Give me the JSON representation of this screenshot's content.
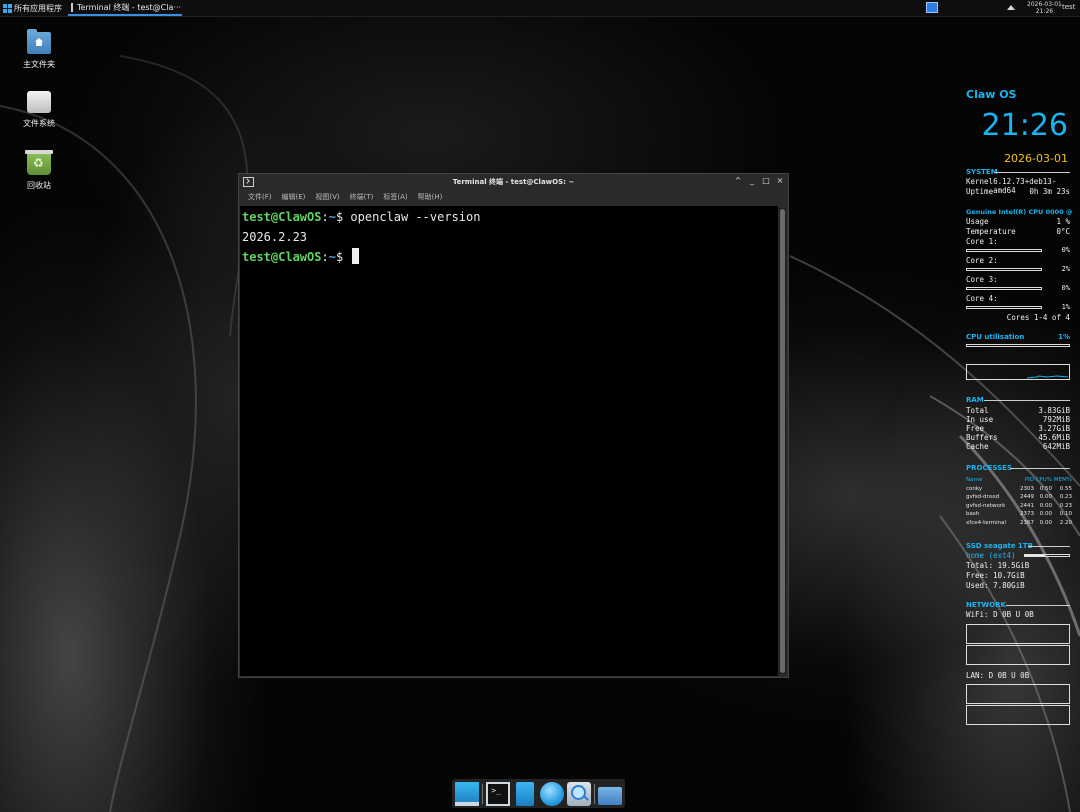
{
  "top_panel": {
    "apps_menu_label": "所有应用程序",
    "task_title": "Terminal 终端 - test@Cla···",
    "clock_date": "2026-03-01",
    "clock_time": "21:26",
    "user": "test"
  },
  "desktop_icons": [
    {
      "label": "主文件夹",
      "icon": "home-folder-icon"
    },
    {
      "label": "文件系统",
      "icon": "drive-icon"
    },
    {
      "label": "回收站",
      "icon": "trash-icon"
    }
  ],
  "terminal": {
    "title": "Terminal 终端 - test@ClawOS: ~",
    "controls": {
      "shade": "^",
      "minimize": "_",
      "maximize": "□",
      "close": "×"
    },
    "menu": [
      "文件(F)",
      "编辑(E)",
      "视图(V)",
      "终端(T)",
      "标签(A)",
      "帮助(H)"
    ],
    "prompt_user": "test@ClawOS",
    "prompt_sep": ":",
    "prompt_path": "~",
    "prompt_symbol": "$",
    "command": "openclaw --version",
    "output": "2026.2.23"
  },
  "conky": {
    "title": "Claw OS",
    "time": "21:26",
    "date": "2026-03-01",
    "system": {
      "heading": "SYSTEM",
      "kernel_label": "Kernel",
      "kernel_value": "6.12.73+deb13-amd64",
      "uptime_label": "Uptime",
      "uptime_value": "0h 3m 23s"
    },
    "cpu": {
      "heading": "Genuine Intel(R) CPU 0000 @",
      "usage_label": "Usage",
      "usage_value": "1 %",
      "temp_label": "Temperature",
      "temp_value": "0°C",
      "cores": [
        {
          "label": "Core 1:",
          "value": "0%"
        },
        {
          "label": "Core 2:",
          "value": "2%"
        },
        {
          "label": "Core 3:",
          "value": "0%"
        },
        {
          "label": "Core 4:",
          "value": "1%"
        }
      ],
      "cores_summary": "Cores 1-4 of 4",
      "util_label": "CPU utilisation",
      "util_value": "1%"
    },
    "ram": {
      "heading": "RAM",
      "rows": [
        {
          "label": "Total",
          "value": "3.83GiB"
        },
        {
          "label": "In use",
          "value": "792MiB"
        },
        {
          "label": "Free",
          "value": "3.27GiB"
        },
        {
          "label": "Buffers",
          "value": "45.6MiB"
        },
        {
          "label": "Cache",
          "value": "642MiB"
        }
      ]
    },
    "processes": {
      "heading": "PROCESSES",
      "columns": [
        "Name",
        "PID",
        "CPU%",
        "MEM%"
      ],
      "rows": [
        [
          "conky",
          "2303",
          "0.50",
          "0.55"
        ],
        [
          "gvfsd-dnssd",
          "2449",
          "0.00",
          "0.23"
        ],
        [
          "gvfsd-network",
          "2441",
          "0.00",
          "0.23"
        ],
        [
          "bash",
          "2373",
          "0.00",
          "0.10"
        ],
        [
          "xfce4-terminal",
          "2367",
          "0.00",
          "2.20"
        ]
      ]
    },
    "disk": {
      "heading": "SSD seagate 1TB",
      "mount": "home (ext4)",
      "total": "Total: 19.5GiB",
      "free": "Free: 10.7GiB",
      "used": "Used: 7.80GiB"
    },
    "network": {
      "heading": "NETWORK",
      "wifi": "WiFi: D 0B  U 0B",
      "lan": "LAN: D 0B  U 0B"
    }
  },
  "dock": [
    "show-desktop-icon",
    "terminal-icon",
    "file-manager-icon",
    "web-browser-icon",
    "app-finder-icon",
    "home-folder-icon"
  ],
  "colors": {
    "accent": "#19b4f0",
    "date": "#f0c020",
    "prompt_user": "#5fd35f",
    "prompt_path": "#5f9ee8"
  }
}
